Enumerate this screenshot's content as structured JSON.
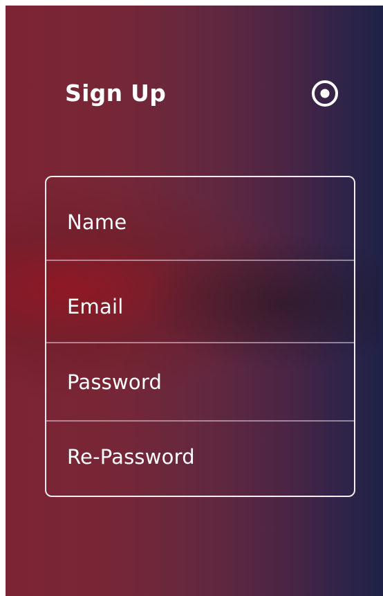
{
  "header": {
    "title": "Sign Up",
    "settings_icon": "radio-target-icon"
  },
  "form": {
    "fields": [
      {
        "placeholder": "Name"
      },
      {
        "placeholder": "Email"
      },
      {
        "placeholder": "Password"
      },
      {
        "placeholder": "Re-Password"
      }
    ]
  },
  "colors": {
    "background_start": "#7d2434",
    "background_end": "#1f2147",
    "text": "#ffffff",
    "border": "#f4eef2"
  }
}
